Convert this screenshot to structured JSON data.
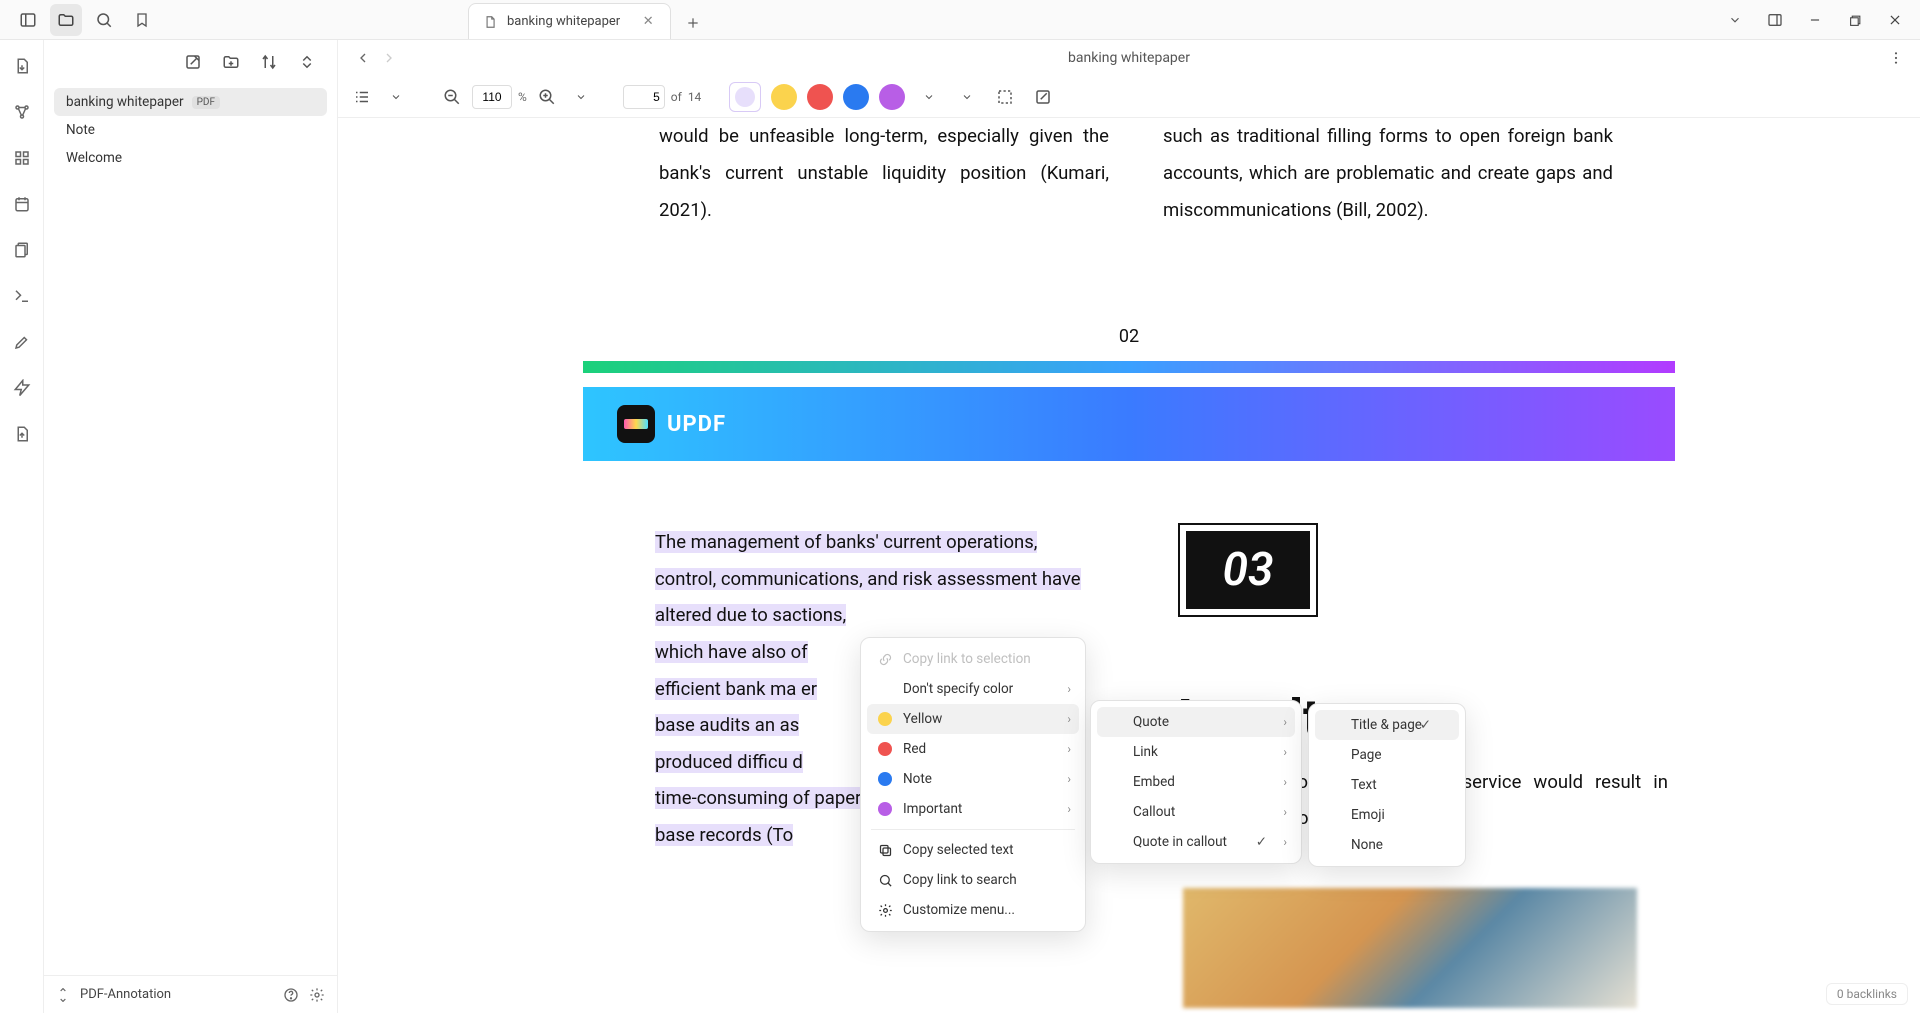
{
  "titlebar": {
    "tab_label": "banking whitepaper",
    "window_controls": {
      "minimize": "–",
      "maximize": "▢",
      "close": "✕"
    }
  },
  "sidebar": {
    "files": [
      {
        "label": "banking whitepaper",
        "badge": "PDF",
        "selected": true
      },
      {
        "label": "Note"
      },
      {
        "label": "Welcome"
      }
    ],
    "footer_label": "PDF-Annotation"
  },
  "viewer": {
    "title": "banking whitepaper",
    "zoom_value": "110",
    "zoom_unit": "%",
    "page_current": "5",
    "page_of": "of",
    "page_total": "14",
    "colors": {
      "selected": "#e7dffb",
      "yellow": "#fbd34d",
      "red": "#ef5350",
      "blue": "#2a7af0",
      "purple": "#b85ee6"
    }
  },
  "document": {
    "page2_left_tail": "would be unfeasible long-term, especially given the bank's current unstable liquidity position (Kumari, 2021).",
    "page2_right_tail": "such as traditional filling forms to open foreign bank accounts, which are problematic and create gaps and miscommunications (Bill, 2002).",
    "page2_num": "02",
    "updf_label": "UPDF",
    "section_badge": "03",
    "loyalty_heading": "Loyalty",
    "loyalty_para": "banking methods, it is                                                         stomer service would result in increased customer loyalty.",
    "highlighted_lines": [
      "The management of banks' current operations,",
      "control, communications, and risk assessment have",
      "altered due to                                                sactions,",
      "which have also                                                     of",
      "efficient bank ma                                                         er",
      "base audits an                                                          as",
      "produced difficu                                                        d",
      "time-consuming                                             of paper",
      "base records (To"
    ]
  },
  "context_menu_1": {
    "items": [
      {
        "id": "copy-link-selection",
        "label": "Copy link to selection",
        "icon": "link",
        "disabled": true
      },
      {
        "id": "dont-specify-color",
        "label": "Don't specify color",
        "chev": true
      },
      {
        "id": "yellow",
        "label": "Yellow",
        "swatch": "#fbd34d",
        "chev": true,
        "hovered": true
      },
      {
        "id": "red",
        "label": "Red",
        "swatch": "#ef5350",
        "chev": true
      },
      {
        "id": "note",
        "label": "Note",
        "swatch": "#2a7af0",
        "chev": true
      },
      {
        "id": "important",
        "label": "Important",
        "swatch": "#b85ee6",
        "chev": true
      },
      {
        "sep": true
      },
      {
        "id": "copy-selected-text",
        "label": "Copy selected text",
        "icon": "copy",
        "normal": true
      },
      {
        "id": "copy-link-search",
        "label": "Copy link to search",
        "icon": "search",
        "normal": true
      },
      {
        "id": "customize-menu",
        "label": "Customize menu...",
        "icon": "gear",
        "normal": true
      }
    ]
  },
  "context_menu_2": {
    "items": [
      {
        "id": "quote",
        "label": "Quote",
        "chev": true,
        "hovered": true
      },
      {
        "id": "link",
        "label": "Link",
        "chev": true
      },
      {
        "id": "embed",
        "label": "Embed",
        "chev": true
      },
      {
        "id": "callout",
        "label": "Callout",
        "chev": true
      },
      {
        "id": "quote-in-callout",
        "label": "Quote in callout",
        "check": true,
        "chev": true
      }
    ]
  },
  "context_menu_3": {
    "items": [
      {
        "id": "title-page",
        "label": "Title & page",
        "check": true,
        "hovered": true
      },
      {
        "id": "page",
        "label": "Page"
      },
      {
        "id": "text",
        "label": "Text"
      },
      {
        "id": "emoji",
        "label": "Emoji"
      },
      {
        "id": "none",
        "label": "None"
      }
    ]
  },
  "footer": {
    "backlinks_label": "0 backlinks"
  }
}
